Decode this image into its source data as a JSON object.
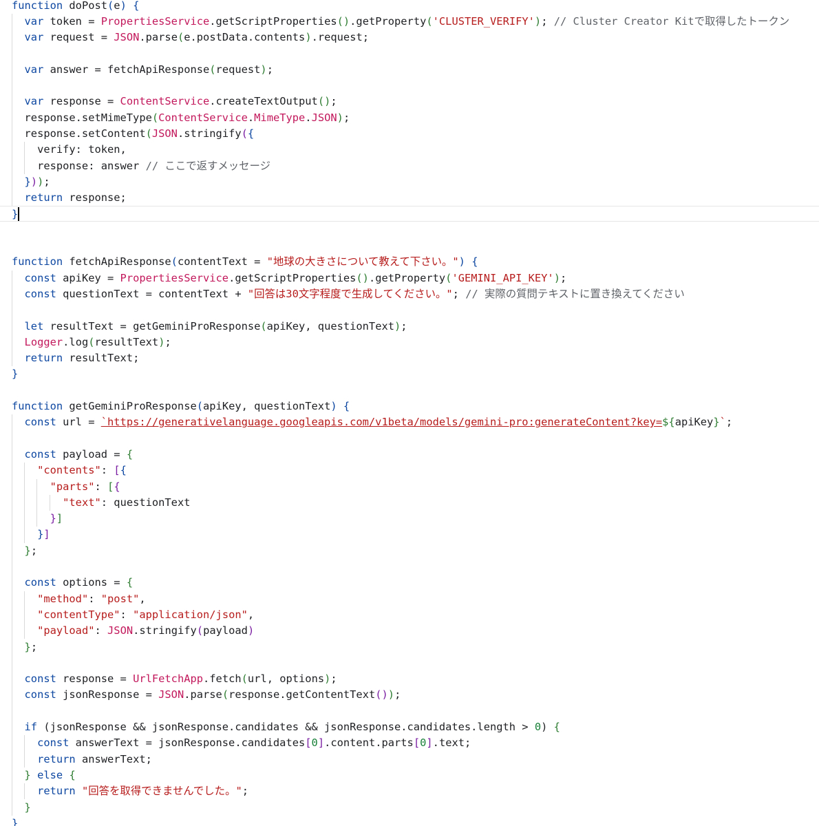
{
  "colors": {
    "default": "#202124",
    "keyword": "#0d47a1",
    "builtin": "#c2185b",
    "string": "#b71c1c",
    "number": "#188038",
    "comment": "#5f6368",
    "bracket1": "#0d47a1",
    "bracket2": "#2e7d32",
    "bracket3": "#7b1fa2",
    "guide": "#d9d9d9"
  },
  "editor": {
    "cursor": {
      "line": 13,
      "col": 1
    },
    "lines": [
      [
        [
          "function",
          "keyword"
        ],
        [
          " doPost",
          "default"
        ],
        [
          "(",
          "bracket1"
        ],
        [
          "e",
          "default"
        ],
        [
          ")",
          "bracket1"
        ],
        [
          " ",
          "default"
        ],
        [
          "{",
          "bracket1"
        ]
      ],
      [
        [
          "  var",
          "keyword"
        ],
        [
          " token = ",
          "default"
        ],
        [
          "PropertiesService",
          "builtin"
        ],
        [
          ".getScriptProperties",
          "default"
        ],
        [
          "()",
          "bracket2"
        ],
        [
          ".getProperty",
          "default"
        ],
        [
          "(",
          "bracket2"
        ],
        [
          "'CLUSTER_VERIFY'",
          "string"
        ],
        [
          ")",
          "bracket2"
        ],
        [
          "; ",
          "default"
        ],
        [
          "// Cluster Creator Kitで取得したトークン",
          "comment"
        ]
      ],
      [
        [
          "  var",
          "keyword"
        ],
        [
          " request = ",
          "default"
        ],
        [
          "JSON",
          "builtin"
        ],
        [
          ".parse",
          "default"
        ],
        [
          "(",
          "bracket2"
        ],
        [
          "e.postData.contents",
          "default"
        ],
        [
          ")",
          "bracket2"
        ],
        [
          ".request;",
          "default"
        ]
      ],
      [],
      [
        [
          "  var",
          "keyword"
        ],
        [
          " answer = fetchApiResponse",
          "default"
        ],
        [
          "(",
          "bracket2"
        ],
        [
          "request",
          "default"
        ],
        [
          ")",
          "bracket2"
        ],
        [
          ";",
          "default"
        ]
      ],
      [],
      [
        [
          "  var",
          "keyword"
        ],
        [
          " response = ",
          "default"
        ],
        [
          "ContentService",
          "builtin"
        ],
        [
          ".createTextOutput",
          "default"
        ],
        [
          "()",
          "bracket2"
        ],
        [
          ";",
          "default"
        ]
      ],
      [
        [
          "  response.setMimeType",
          "default"
        ],
        [
          "(",
          "bracket2"
        ],
        [
          "ContentService",
          "builtin"
        ],
        [
          ".",
          "default"
        ],
        [
          "MimeType",
          "builtin"
        ],
        [
          ".",
          "default"
        ],
        [
          "JSON",
          "builtin"
        ],
        [
          ")",
          "bracket2"
        ],
        [
          ";",
          "default"
        ]
      ],
      [
        [
          "  response.setContent",
          "default"
        ],
        [
          "(",
          "bracket2"
        ],
        [
          "JSON",
          "builtin"
        ],
        [
          ".stringify",
          "default"
        ],
        [
          "(",
          "bracket3"
        ],
        [
          "{",
          "bracket1"
        ]
      ],
      [
        [
          "    verify: token,",
          "default"
        ]
      ],
      [
        [
          "    response: answer ",
          "default"
        ],
        [
          "// ここで返すメッセージ",
          "comment"
        ]
      ],
      [
        [
          "  ",
          "default"
        ],
        [
          "}",
          "bracket1"
        ],
        [
          ")",
          "bracket3"
        ],
        [
          ")",
          "bracket2"
        ],
        [
          ";",
          "default"
        ]
      ],
      [
        [
          "  return",
          "keyword"
        ],
        [
          " response;",
          "default"
        ]
      ],
      [
        [
          "}",
          "bracket1"
        ]
      ],
      [],
      [],
      [
        [
          "function",
          "keyword"
        ],
        [
          " fetchApiResponse",
          "default"
        ],
        [
          "(",
          "bracket1"
        ],
        [
          "contentText = ",
          "default"
        ],
        [
          "\"地球の大きさについて教えて下さい。\"",
          "string"
        ],
        [
          ") ",
          "bracket1"
        ],
        [
          "{",
          "bracket1"
        ]
      ],
      [
        [
          "  const",
          "keyword"
        ],
        [
          " apiKey = ",
          "default"
        ],
        [
          "PropertiesService",
          "builtin"
        ],
        [
          ".getScriptProperties",
          "default"
        ],
        [
          "()",
          "bracket2"
        ],
        [
          ".getProperty",
          "default"
        ],
        [
          "(",
          "bracket2"
        ],
        [
          "'GEMINI_API_KEY'",
          "string"
        ],
        [
          ")",
          "bracket2"
        ],
        [
          ";",
          "default"
        ]
      ],
      [
        [
          "  const",
          "keyword"
        ],
        [
          " questionText = contentText + ",
          "default"
        ],
        [
          "\"回答は30文字程度で生成してください。\"",
          "string"
        ],
        [
          "; ",
          "default"
        ],
        [
          "// 実際の質問テキストに置き換えてください",
          "comment"
        ]
      ],
      [],
      [
        [
          "  let",
          "keyword"
        ],
        [
          " resultText = getGeminiProResponse",
          "default"
        ],
        [
          "(",
          "bracket2"
        ],
        [
          "apiKey, questionText",
          "default"
        ],
        [
          ")",
          "bracket2"
        ],
        [
          ";",
          "default"
        ]
      ],
      [
        [
          "  ",
          "default"
        ],
        [
          "Logger",
          "builtin"
        ],
        [
          ".log",
          "default"
        ],
        [
          "(",
          "bracket2"
        ],
        [
          "resultText",
          "default"
        ],
        [
          ")",
          "bracket2"
        ],
        [
          ";",
          "default"
        ]
      ],
      [
        [
          "  return",
          "keyword"
        ],
        [
          " resultText;",
          "default"
        ]
      ],
      [
        [
          "}",
          "bracket1"
        ]
      ],
      [],
      [
        [
          "function",
          "keyword"
        ],
        [
          " getGeminiProResponse",
          "default"
        ],
        [
          "(",
          "bracket1"
        ],
        [
          "apiKey, questionText",
          "default"
        ],
        [
          ") ",
          "bracket1"
        ],
        [
          "{",
          "bracket1"
        ]
      ],
      [
        [
          "  const",
          "keyword"
        ],
        [
          " url = ",
          "default"
        ],
        [
          "`https://generativelanguage.googleapis.com/v1beta/models/gemini-pro:generateContent?key=",
          "string"
        ],
        [
          "${",
          "bracket2"
        ],
        [
          "apiKey",
          "default"
        ],
        [
          "}",
          "bracket2"
        ],
        [
          "`",
          "string"
        ],
        [
          ";",
          "default"
        ]
      ],
      [],
      [
        [
          "  const",
          "keyword"
        ],
        [
          " payload = ",
          "default"
        ],
        [
          "{",
          "bracket2"
        ]
      ],
      [
        [
          "    ",
          "default"
        ],
        [
          "\"contents\"",
          "string"
        ],
        [
          ": ",
          "default"
        ],
        [
          "[",
          "bracket3"
        ],
        [
          "{",
          "bracket1"
        ]
      ],
      [
        [
          "      ",
          "default"
        ],
        [
          "\"parts\"",
          "string"
        ],
        [
          ": ",
          "default"
        ],
        [
          "[",
          "bracket2"
        ],
        [
          "{",
          "bracket3"
        ]
      ],
      [
        [
          "        ",
          "default"
        ],
        [
          "\"text\"",
          "string"
        ],
        [
          ": questionText",
          "default"
        ]
      ],
      [
        [
          "      ",
          "default"
        ],
        [
          "}",
          "bracket3"
        ],
        [
          "]",
          "bracket2"
        ]
      ],
      [
        [
          "    ",
          "default"
        ],
        [
          "}",
          "bracket1"
        ],
        [
          "]",
          "bracket3"
        ]
      ],
      [
        [
          "  ",
          "default"
        ],
        [
          "}",
          "bracket2"
        ],
        [
          ";",
          "default"
        ]
      ],
      [],
      [
        [
          "  const",
          "keyword"
        ],
        [
          " options = ",
          "default"
        ],
        [
          "{",
          "bracket2"
        ]
      ],
      [
        [
          "    ",
          "default"
        ],
        [
          "\"method\"",
          "string"
        ],
        [
          ": ",
          "default"
        ],
        [
          "\"post\"",
          "string"
        ],
        [
          ",",
          "default"
        ]
      ],
      [
        [
          "    ",
          "default"
        ],
        [
          "\"contentType\"",
          "string"
        ],
        [
          ": ",
          "default"
        ],
        [
          "\"application/json\"",
          "string"
        ],
        [
          ",",
          "default"
        ]
      ],
      [
        [
          "    ",
          "default"
        ],
        [
          "\"payload\"",
          "string"
        ],
        [
          ": ",
          "default"
        ],
        [
          "JSON",
          "builtin"
        ],
        [
          ".stringify",
          "default"
        ],
        [
          "(",
          "bracket3"
        ],
        [
          "payload",
          "default"
        ],
        [
          ")",
          "bracket3"
        ]
      ],
      [
        [
          "  ",
          "default"
        ],
        [
          "}",
          "bracket2"
        ],
        [
          ";",
          "default"
        ]
      ],
      [],
      [
        [
          "  const",
          "keyword"
        ],
        [
          " response = ",
          "default"
        ],
        [
          "UrlFetchApp",
          "builtin"
        ],
        [
          ".fetch",
          "default"
        ],
        [
          "(",
          "bracket2"
        ],
        [
          "url, options",
          "default"
        ],
        [
          ")",
          "bracket2"
        ],
        [
          ";",
          "default"
        ]
      ],
      [
        [
          "  const",
          "keyword"
        ],
        [
          " jsonResponse = ",
          "default"
        ],
        [
          "JSON",
          "builtin"
        ],
        [
          ".parse",
          "default"
        ],
        [
          "(",
          "bracket2"
        ],
        [
          "response.getContentText",
          "default"
        ],
        [
          "()",
          "bracket3"
        ],
        [
          ")",
          "bracket2"
        ],
        [
          ";",
          "default"
        ]
      ],
      [],
      [
        [
          "  if",
          "keyword"
        ],
        [
          " (jsonResponse && jsonResponse.candidates && jsonResponse.candidates.length > ",
          "default"
        ],
        [
          "0",
          "number"
        ],
        [
          ") ",
          "default"
        ],
        [
          "{",
          "bracket2"
        ]
      ],
      [
        [
          "    const",
          "keyword"
        ],
        [
          " answerText = jsonResponse.candidates",
          "default"
        ],
        [
          "[",
          "bracket3"
        ],
        [
          "0",
          "number"
        ],
        [
          "]",
          "bracket3"
        ],
        [
          ".content.parts",
          "default"
        ],
        [
          "[",
          "bracket3"
        ],
        [
          "0",
          "number"
        ],
        [
          "]",
          "bracket3"
        ],
        [
          ".text;",
          "default"
        ]
      ],
      [
        [
          "    return",
          "keyword"
        ],
        [
          " answerText;",
          "default"
        ]
      ],
      [
        [
          "  ",
          "default"
        ],
        [
          "}",
          "bracket2"
        ],
        [
          " else ",
          "keyword"
        ],
        [
          "{",
          "bracket2"
        ]
      ],
      [
        [
          "    return",
          "keyword"
        ],
        [
          " ",
          "default"
        ],
        [
          "\"回答を取得できませんでした。\"",
          "string"
        ],
        [
          ";",
          "default"
        ]
      ],
      [
        [
          "  ",
          "default"
        ],
        [
          "}",
          "bracket2"
        ]
      ],
      [
        [
          "}",
          "bracket1"
        ]
      ]
    ]
  }
}
